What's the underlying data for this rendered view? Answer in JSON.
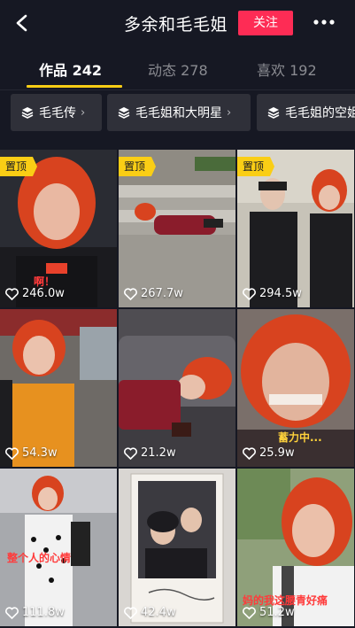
{
  "header": {
    "title": "多余和毛毛姐",
    "follow_label": "关注"
  },
  "tabs": [
    {
      "label": "作品 242"
    },
    {
      "label": "动态 278"
    },
    {
      "label": "喜欢 192"
    }
  ],
  "collections": [
    {
      "label": "毛毛传"
    },
    {
      "label": "毛毛姐和大明星"
    },
    {
      "label": "毛毛姐的空姐"
    }
  ],
  "pin_label": "置顶",
  "videos": [
    {
      "likes": "246.0w",
      "pinned": true,
      "caption": "啊！"
    },
    {
      "likes": "267.7w",
      "pinned": true
    },
    {
      "likes": "294.5w",
      "pinned": true
    },
    {
      "likes": "54.3w"
    },
    {
      "likes": "21.2w"
    },
    {
      "likes": "25.9w",
      "caption": "蓄力中..."
    },
    {
      "likes": "111.8w",
      "caption": "整个人的心情"
    },
    {
      "likes": "42.4w"
    },
    {
      "likes": "51.2w",
      "caption": "妈的我这腰青好痛"
    }
  ],
  "colors": {
    "background": "#161823",
    "accent_red": "#fe2c55",
    "pin_yellow": "#face15"
  }
}
